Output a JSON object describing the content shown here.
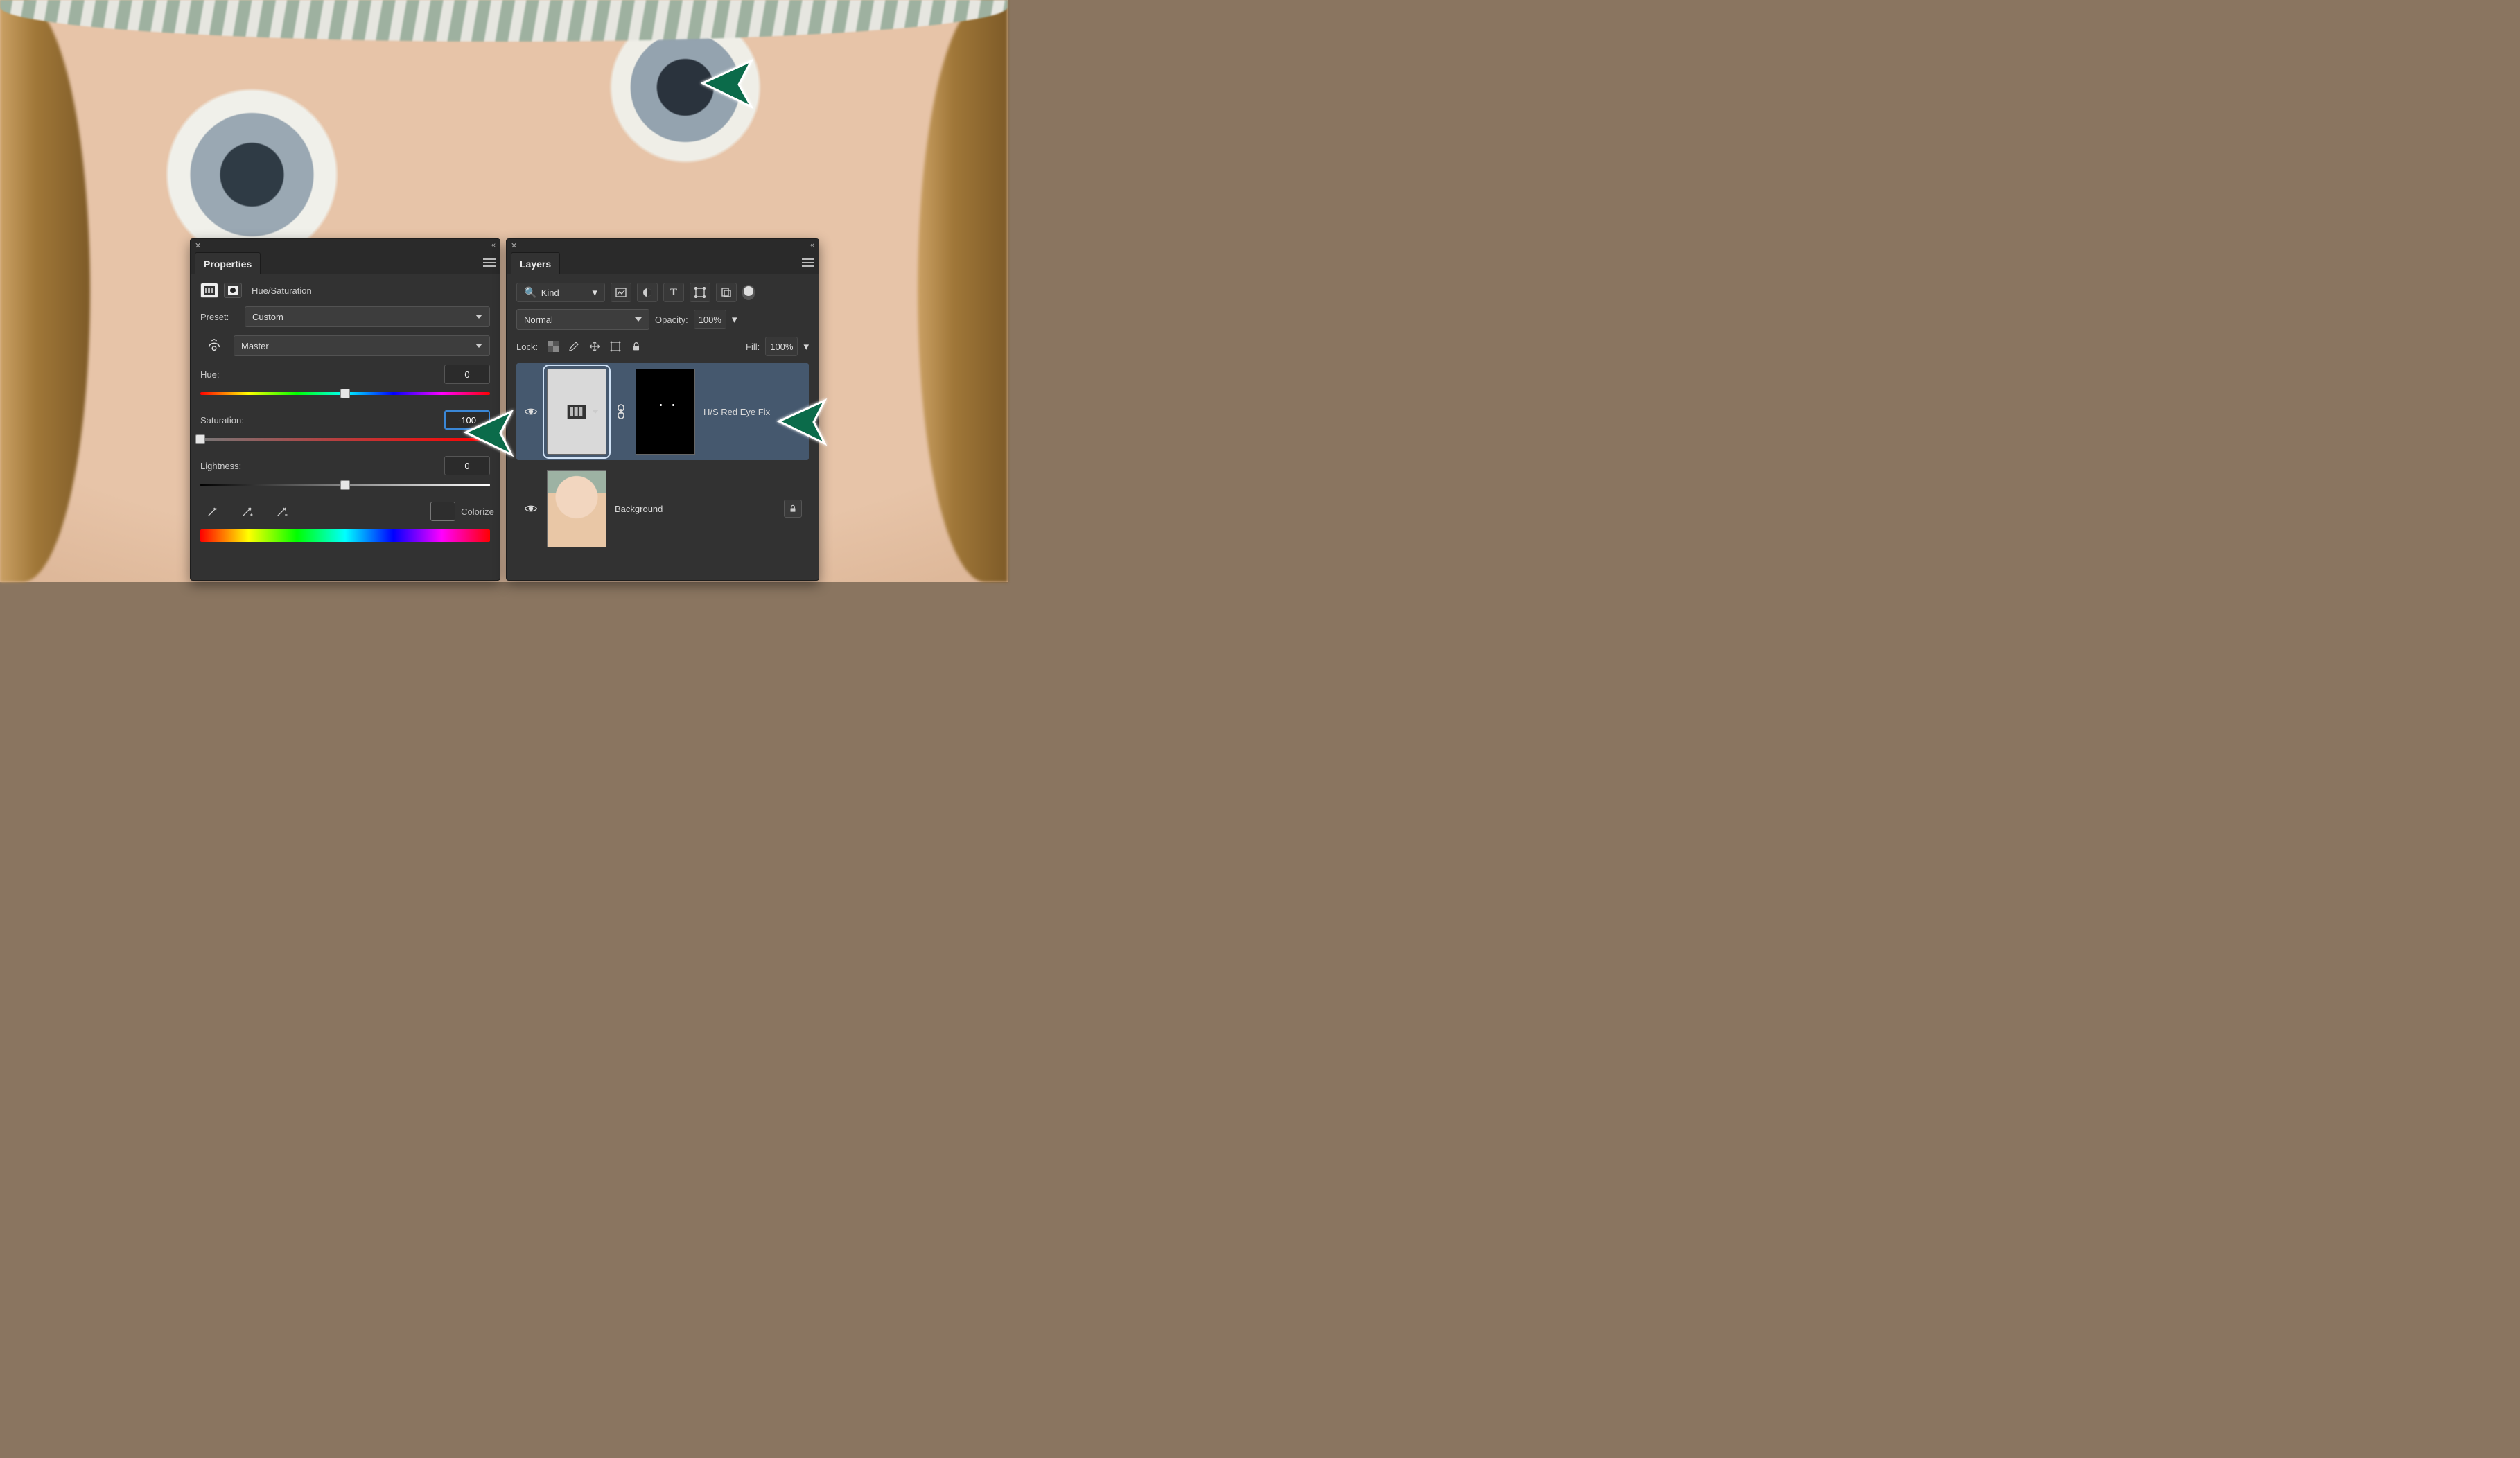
{
  "properties": {
    "tab_label": "Properties",
    "adjustment_label": "Hue/Saturation",
    "preset_label": "Preset:",
    "preset_value": "Custom",
    "channel_value": "Master",
    "hue_label": "Hue:",
    "hue_value": "0",
    "hue_thumb_pct": 50,
    "saturation_label": "Saturation:",
    "saturation_value": "-100",
    "saturation_thumb_pct": 0,
    "lightness_label": "Lightness:",
    "lightness_value": "0",
    "lightness_thumb_pct": 50,
    "colorize_label": "Colorize"
  },
  "layers": {
    "tab_label": "Layers",
    "filter_label": "Kind",
    "blend_mode": "Normal",
    "opacity_label": "Opacity:",
    "opacity_value": "100%",
    "lock_label": "Lock:",
    "fill_label": "Fill:",
    "fill_value": "100%",
    "items": [
      {
        "name": "H/S Red Eye Fix",
        "selected": true,
        "type": "adjustment"
      },
      {
        "name": "Background",
        "selected": false,
        "type": "pixel",
        "locked": true
      }
    ]
  },
  "arrows": {
    "color": "#0b6b4a"
  }
}
